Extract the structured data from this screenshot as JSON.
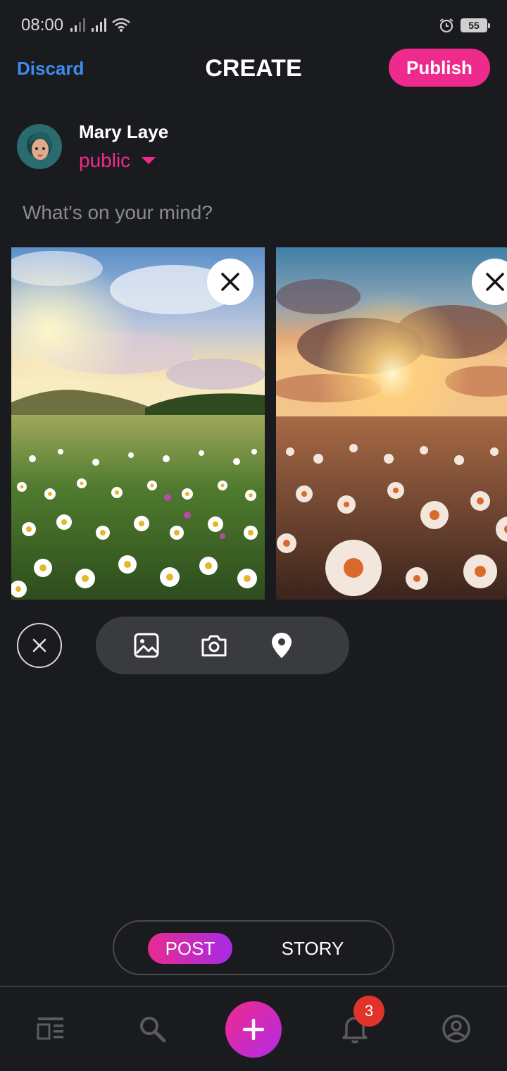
{
  "status_bar": {
    "time": "08:00",
    "battery": "55"
  },
  "header": {
    "discard_label": "Discard",
    "title": "CREATE",
    "publish_label": "Publish"
  },
  "user": {
    "name": "Mary Laye",
    "privacy": "public"
  },
  "composer": {
    "placeholder": "What's on your mind?"
  },
  "attachments": [
    {
      "name": "daisy-field-daylight"
    },
    {
      "name": "daisy-field-sunset"
    }
  ],
  "toolbar": {
    "icons": [
      "close-icon",
      "image-icon",
      "camera-icon",
      "location-pin-icon"
    ]
  },
  "mode_switch": {
    "post_label": "POST",
    "story_label": "STORY",
    "active": "POST"
  },
  "bottom_nav": {
    "items": [
      "feed-icon",
      "search-icon",
      "add-icon",
      "bell-icon",
      "profile-icon"
    ],
    "notification_count": "3"
  },
  "colors": {
    "accent": "#ee2a8c",
    "link": "#3d8cf0",
    "background": "#1a1b1e",
    "badge": "#e0332c"
  }
}
